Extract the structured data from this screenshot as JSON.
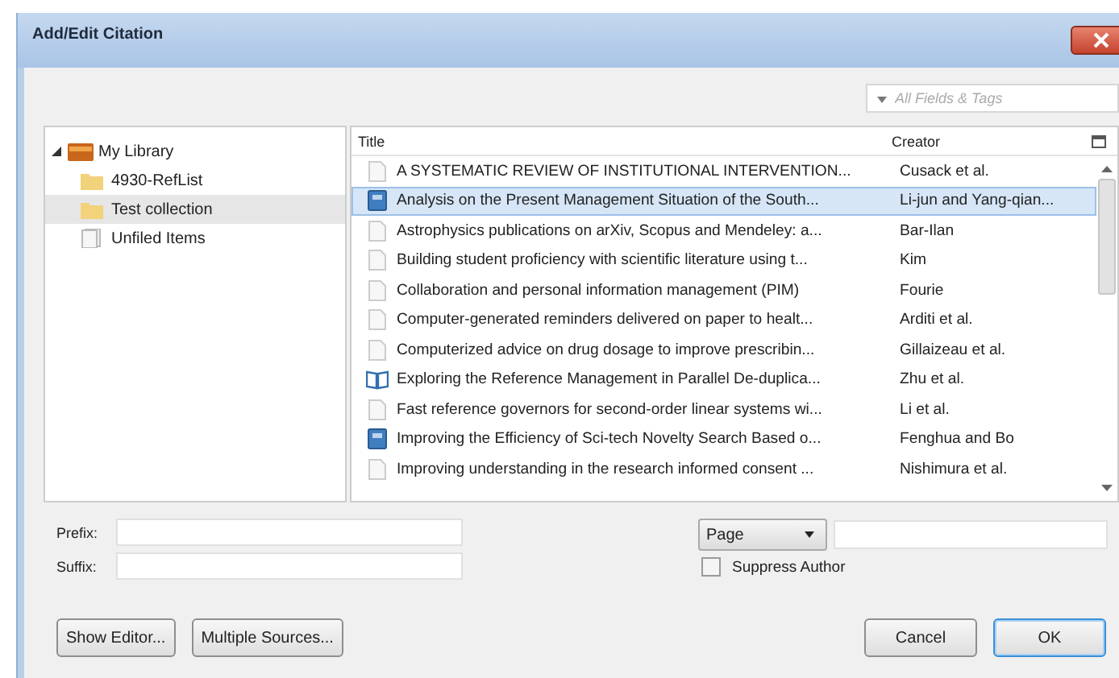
{
  "window": {
    "title": "Add/Edit Citation"
  },
  "search": {
    "placeholder": "All Fields & Tags"
  },
  "sidebar": {
    "items": [
      {
        "label": "My Library",
        "kind": "library",
        "selected": false,
        "expanded": true,
        "children": [
          {
            "label": "4930-RefList",
            "kind": "folder",
            "selected": false
          },
          {
            "label": "Test collection",
            "kind": "folder",
            "selected": true
          },
          {
            "label": "Unfiled Items",
            "kind": "unfiled",
            "selected": false
          }
        ]
      }
    ]
  },
  "table": {
    "columns": [
      "Title",
      "Creator"
    ],
    "rows": [
      {
        "title": "A SYSTEMATIC REVIEW OF INSTITUTIONAL INTERVENTION...",
        "creator": "Cusack et al.",
        "kind": "document",
        "selected": false
      },
      {
        "title": "Analysis on the Present Management Situation of the South...",
        "creator": "Li-jun and Yang-qian...",
        "kind": "journal",
        "selected": true
      },
      {
        "title": "Astrophysics publications on arXiv, Scopus and Mendeley: a...",
        "creator": "Bar-Ilan",
        "kind": "document",
        "selected": false
      },
      {
        "title": "Building student proficiency with scientific literature using t...",
        "creator": "Kim",
        "kind": "document",
        "selected": false
      },
      {
        "title": "Collaboration and personal information management (PIM)",
        "creator": "Fourie",
        "kind": "document",
        "selected": false
      },
      {
        "title": "Computer-generated reminders delivered on paper to healt...",
        "creator": "Arditi et al.",
        "kind": "document",
        "selected": false
      },
      {
        "title": "Computerized advice on drug dosage to improve prescribin...",
        "creator": "Gillaizeau et al.",
        "kind": "document",
        "selected": false
      },
      {
        "title": "Exploring the Reference Management in Parallel De-duplica...",
        "creator": "Zhu et al.",
        "kind": "book",
        "selected": false
      },
      {
        "title": "Fast reference governors for second-order linear systems wi...",
        "creator": "Li et al.",
        "kind": "document",
        "selected": false
      },
      {
        "title": "Improving the Efficiency of Sci-tech Novelty Search Based o...",
        "creator": "Fenghua and Bo",
        "kind": "journal",
        "selected": false
      },
      {
        "title": "Improving understanding in the research informed consent ...",
        "creator": "Nishimura et al.",
        "kind": "document",
        "selected": false
      }
    ]
  },
  "form": {
    "prefix_label": "Prefix:",
    "suffix_label": "Suffix:",
    "locator": "Page",
    "suppress_author": {
      "label": "Suppress Author",
      "checked": false
    }
  },
  "buttons": [
    {
      "label": "Show Editor...",
      "kind": "left"
    },
    {
      "label": "Multiple Sources...",
      "kind": "left"
    },
    {
      "label": "Cancel",
      "kind": "right"
    },
    {
      "label": "OK",
      "kind": "default"
    }
  ]
}
